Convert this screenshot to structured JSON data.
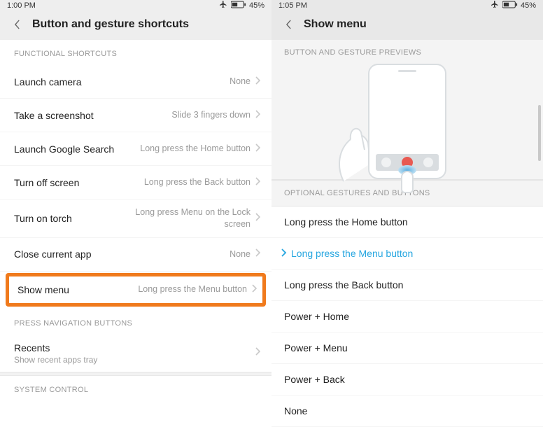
{
  "left": {
    "status": {
      "time": "1:00 PM",
      "battery": "45%"
    },
    "header": {
      "title": "Button and gesture shortcuts"
    },
    "sections": {
      "functional": {
        "label": "FUNCTIONAL SHORTCUTS",
        "items": [
          {
            "title": "Launch camera",
            "value": "None"
          },
          {
            "title": "Take a screenshot",
            "value": "Slide 3 fingers down"
          },
          {
            "title": "Launch Google Search",
            "value": "Long press the Home button"
          },
          {
            "title": "Turn off screen",
            "value": "Long press the Back button"
          },
          {
            "title": "Turn on torch",
            "value": "Long press Menu on the Lock screen"
          },
          {
            "title": "Close current app",
            "value": "None"
          },
          {
            "title": "Show menu",
            "value": "Long press the Menu button"
          }
        ]
      },
      "press_nav": {
        "label": "PRESS NAVIGATION BUTTONS",
        "items": [
          {
            "title": "Recents",
            "sub": "Show recent apps tray"
          }
        ]
      },
      "system": {
        "label": "SYSTEM CONTROL"
      }
    }
  },
  "right": {
    "status": {
      "time": "1:05 PM",
      "battery": "45%"
    },
    "header": {
      "title": "Show menu"
    },
    "preview_label": "BUTTON AND GESTURE PREVIEWS",
    "options_label": "OPTIONAL GESTURES AND BUTTONS",
    "options": [
      {
        "label": "Long press the Home button",
        "selected": false
      },
      {
        "label": "Long press the Menu button",
        "selected": true
      },
      {
        "label": "Long press the Back button",
        "selected": false
      },
      {
        "label": "Power + Home",
        "selected": false
      },
      {
        "label": "Power + Menu",
        "selected": false
      },
      {
        "label": "Power + Back",
        "selected": false
      },
      {
        "label": "None",
        "selected": false
      }
    ]
  }
}
